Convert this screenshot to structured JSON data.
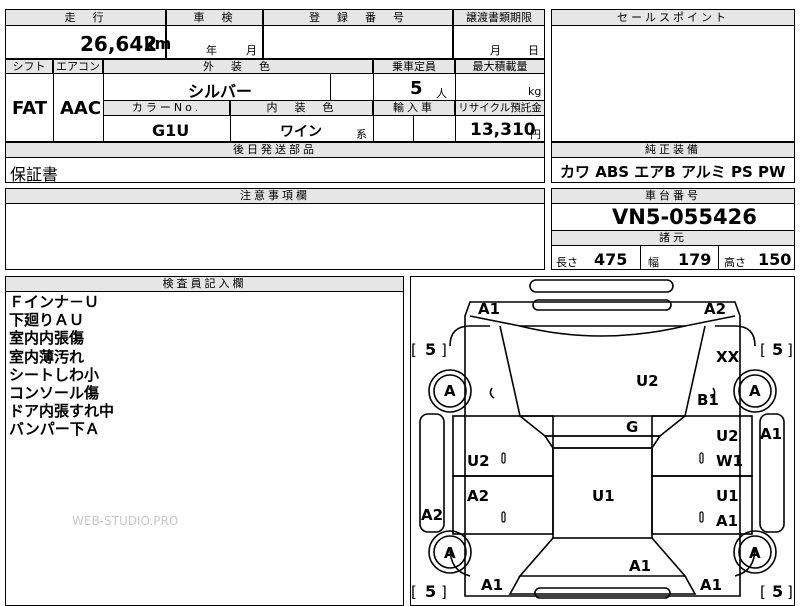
{
  "row1": {
    "mileage_label": "走　行",
    "inspection_label": "車　検",
    "registration_label": "登　録　番　号",
    "transfer_label": "譲渡書類期限",
    "sales_point_label": "セールスポイント",
    "mileage_value": "26,642",
    "mileage_unit": "km",
    "year_unit": "年",
    "month_unit": "月",
    "month_unit2": "月",
    "day_unit": "日"
  },
  "row2": {
    "shift_label": "シフト",
    "ac_label": "エアコン",
    "exterior_color_label": "外　装　色",
    "capacity_label": "乗車定員",
    "max_load_label": "最大積載量",
    "shift_value": "FAT",
    "ac_value": "AAC",
    "exterior_color_value": "シルバー",
    "capacity_value": "5",
    "capacity_unit": "人",
    "load_unit": "kg",
    "color_no_label": "カラーNo.",
    "interior_color_label": "内　装　色",
    "import_label": "輸入車",
    "recycle_label": "リサイクル預託金",
    "color_no_value": "G1U",
    "interior_color_value": "ワイン",
    "interior_color_suffix": "系",
    "recycle_value": "13,310",
    "recycle_unit": "円"
  },
  "equipment": {
    "label": "純正装備",
    "value": "カワ ABS エアB アルミ PS PW"
  },
  "later_parts": {
    "label": "後日発送部品",
    "value": "保証書"
  },
  "notes": {
    "label": "注意事項欄"
  },
  "chassis": {
    "label": "車台番号",
    "value": "VN5-055426"
  },
  "dimensions": {
    "label": "諸元",
    "length_label": "長さ",
    "length_value": "475",
    "width_label": "幅",
    "width_value": "179",
    "height_label": "高さ",
    "height_value": "150"
  },
  "inspector": {
    "label": "検査員記入欄",
    "lines": [
      "Ｆインナ－Ｕ",
      "下廻りＡＵ",
      "室内内張傷",
      "室内薄汚れ",
      "シートしわ小",
      "コンソール傷",
      "ドア内張すれ中",
      "バンパー下Ａ"
    ]
  },
  "watermark": "WEB-STUDIO.PRO",
  "diagram": {
    "tire_tl": "5",
    "tire_tr": "5",
    "tire_bl": "5",
    "tire_br": "5",
    "marks": {
      "front_left_corner": "A1",
      "front_right_corner": "A2",
      "xx": "XX",
      "front_left_wheel": "A",
      "front_right_wheel": "A",
      "hood": "U2",
      "front_right_fender": "B1",
      "windshield": "G",
      "right_a_pillar": "A1",
      "front_left_door": "U2",
      "front_right_door_upper": "U2",
      "front_right_door_lower": "W1",
      "rear_left_door": "A2",
      "roof": "U1",
      "rear_right_door_upper": "U1",
      "rear_right_door_lower": "A1",
      "left_sill": "A2",
      "rear_left_wheel": "A",
      "rear_right_wheel": "A",
      "trunk": "A1",
      "rear_left_corner": "A1",
      "rear_right_corner": "A1"
    }
  }
}
